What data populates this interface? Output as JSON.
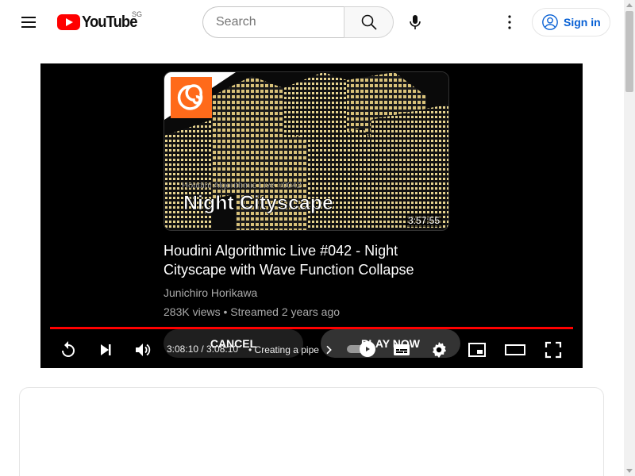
{
  "header": {
    "logo_text": "YouTube",
    "region": "SG",
    "search_placeholder": "Search",
    "signin_label": "Sign in"
  },
  "endscreen": {
    "thumbnail_series": "Houdini Algorithmic Live #0042",
    "thumbnail_title": "Night Cityscape",
    "duration": "3:57:55",
    "title": "Houdini Algorithmic Live #042 - Night Cityscape with Wave Function Collapse",
    "channel": "Junichiro Horikawa",
    "meta": "283K views • Streamed 2 years ago",
    "cancel_label": "CANCEL",
    "play_now_label": "PLAY NOW"
  },
  "player": {
    "time": "3:08:10 / 3:08:10",
    "chapter": "• Creating a pipe",
    "progress": 1.0,
    "accent": "#ff0000"
  },
  "colors": {
    "brand": "#ff0000",
    "link": "#065fd4"
  },
  "icons": [
    "menu-icon",
    "search-icon",
    "mic-icon",
    "more-vert-icon",
    "account-icon",
    "replay-icon",
    "next-icon",
    "volume-icon",
    "chevron-right-icon",
    "subtitles-icon",
    "settings-icon",
    "miniplayer-icon",
    "theater-icon",
    "fullscreen-icon",
    "houdini-logo"
  ]
}
